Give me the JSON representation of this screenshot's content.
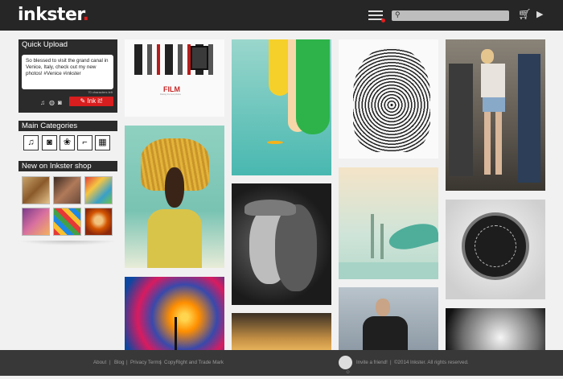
{
  "header": {
    "logo_text": "inkster",
    "logo_dot": ".",
    "search_placeholder": "",
    "icons": [
      "menu-icon",
      "search-icon",
      "cart-icon",
      "play-icon"
    ]
  },
  "quick_upload": {
    "title": "Quick Upload",
    "text": "So blessed to visit the grand canal in Venice, Italy, check out my new photos! #Venice #inkster",
    "chars_left": "70 characters left",
    "button": "Ink it!",
    "icons": [
      "music-icon",
      "globe-icon",
      "camera-icon"
    ]
  },
  "categories": {
    "title": "Main Categories",
    "items": [
      "music-icon",
      "camera-icon",
      "film-reel-icon",
      "shoe-icon",
      "clapperboard-icon"
    ]
  },
  "shop": {
    "title": "New on Inkster shop"
  },
  "grid": {
    "film_title": "FILM",
    "film_sub": "Making the best photos"
  },
  "footer": {
    "about": "About",
    "sep1": "|",
    "blog": "Blog",
    "sep2": "|",
    "privacy": "Privacy Terms",
    "sep3": "|",
    "copyright_tm": "CopyRight and Trade Mark",
    "invite": "Invite a friend!",
    "sep4": "|",
    "copyright": "©2014 Inkster. All rights reserved."
  },
  "colors": {
    "brand": "#e11d1d",
    "bar": "#262626"
  }
}
